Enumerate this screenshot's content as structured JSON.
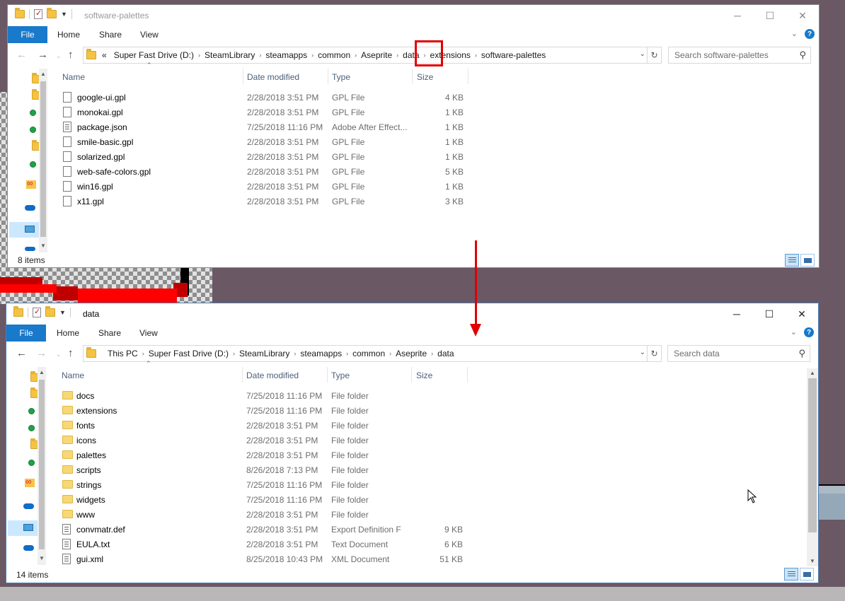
{
  "colors": {
    "accent": "#1979ca",
    "desktop": "#6a5865",
    "annotation": "#e00000",
    "folder": "#f8d775"
  },
  "top_window": {
    "title": "software-palettes",
    "ribbon": {
      "file": "File",
      "home": "Home",
      "share": "Share",
      "view": "View"
    },
    "address": [
      "«",
      "Super Fast Drive (D:)",
      "SteamLibrary",
      "steamapps",
      "common",
      "Aseprite",
      "data",
      "extensions",
      "software-palettes"
    ],
    "search_placeholder": "Search software-palettes",
    "columns": {
      "name": "Name",
      "date": "Date modified",
      "type": "Type",
      "size": "Size"
    },
    "rows": [
      {
        "name": "google-ui.gpl",
        "date": "2/28/2018 3:51 PM",
        "type": "GPL File",
        "size": "4 KB",
        "icon": "file-icon"
      },
      {
        "name": "monokai.gpl",
        "date": "2/28/2018 3:51 PM",
        "type": "GPL File",
        "size": "1 KB",
        "icon": "file-icon"
      },
      {
        "name": "package.json",
        "date": "7/25/2018 11:16 PM",
        "type": "Adobe After Effect...",
        "size": "1 KB",
        "icon": "text-file-icon"
      },
      {
        "name": "smile-basic.gpl",
        "date": "2/28/2018 3:51 PM",
        "type": "GPL File",
        "size": "1 KB",
        "icon": "file-icon"
      },
      {
        "name": "solarized.gpl",
        "date": "2/28/2018 3:51 PM",
        "type": "GPL File",
        "size": "1 KB",
        "icon": "file-icon"
      },
      {
        "name": "web-safe-colors.gpl",
        "date": "2/28/2018 3:51 PM",
        "type": "GPL File",
        "size": "5 KB",
        "icon": "file-icon"
      },
      {
        "name": "win16.gpl",
        "date": "2/28/2018 3:51 PM",
        "type": "GPL File",
        "size": "1 KB",
        "icon": "file-icon"
      },
      {
        "name": "x11.gpl",
        "date": "2/28/2018 3:51 PM",
        "type": "GPL File",
        "size": "3 KB",
        "icon": "file-icon"
      }
    ],
    "status": "8 items"
  },
  "bottom_window": {
    "title": "data",
    "ribbon": {
      "file": "File",
      "home": "Home",
      "share": "Share",
      "view": "View"
    },
    "address": [
      "This PC",
      "Super Fast Drive (D:)",
      "SteamLibrary",
      "steamapps",
      "common",
      "Aseprite",
      "data"
    ],
    "search_placeholder": "Search data",
    "columns": {
      "name": "Name",
      "date": "Date modified",
      "type": "Type",
      "size": "Size"
    },
    "rows": [
      {
        "name": "docs",
        "date": "7/25/2018 11:16 PM",
        "type": "File folder",
        "size": "",
        "icon": "folder-icon"
      },
      {
        "name": "extensions",
        "date": "7/25/2018 11:16 PM",
        "type": "File folder",
        "size": "",
        "icon": "folder-icon"
      },
      {
        "name": "fonts",
        "date": "2/28/2018 3:51 PM",
        "type": "File folder",
        "size": "",
        "icon": "folder-icon"
      },
      {
        "name": "icons",
        "date": "2/28/2018 3:51 PM",
        "type": "File folder",
        "size": "",
        "icon": "folder-icon"
      },
      {
        "name": "palettes",
        "date": "2/28/2018 3:51 PM",
        "type": "File folder",
        "size": "",
        "icon": "folder-icon"
      },
      {
        "name": "scripts",
        "date": "8/26/2018 7:13 PM",
        "type": "File folder",
        "size": "",
        "icon": "folder-icon"
      },
      {
        "name": "strings",
        "date": "7/25/2018 11:16 PM",
        "type": "File folder",
        "size": "",
        "icon": "folder-icon"
      },
      {
        "name": "widgets",
        "date": "7/25/2018 11:16 PM",
        "type": "File folder",
        "size": "",
        "icon": "folder-icon"
      },
      {
        "name": "www",
        "date": "2/28/2018 3:51 PM",
        "type": "File folder",
        "size": "",
        "icon": "folder-icon"
      },
      {
        "name": "convmatr.def",
        "date": "2/28/2018 3:51 PM",
        "type": "Export Definition F",
        "size": "9 KB",
        "icon": "text-file-icon"
      },
      {
        "name": "EULA.txt",
        "date": "2/28/2018 3:51 PM",
        "type": "Text Document",
        "size": "6 KB",
        "icon": "text-file-icon"
      },
      {
        "name": "gui.xml",
        "date": "8/25/2018 10:43 PM",
        "type": "XML Document",
        "size": "51 KB",
        "icon": "text-file-icon"
      }
    ],
    "status": "14 items"
  }
}
